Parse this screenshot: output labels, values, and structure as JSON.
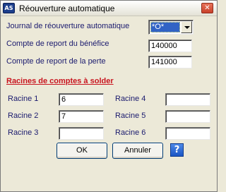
{
  "window": {
    "title": "Réouverture automatique",
    "app_icon_text": "AS",
    "close_glyph": "✕"
  },
  "form": {
    "journal_label": "Journal de réouverture automatique",
    "journal_value": "*O*",
    "benefice_label": "Compte de report du bénéfice",
    "benefice_value": "140000",
    "perte_label": "Compte de report de la perte",
    "perte_value": "141000"
  },
  "section": {
    "title": "Racines de comptes à solder"
  },
  "racines": [
    {
      "label": "Racine 1",
      "value": "6"
    },
    {
      "label": "Racine 2",
      "value": "7"
    },
    {
      "label": "Racine 3",
      "value": ""
    },
    {
      "label": "Racine 4",
      "value": ""
    },
    {
      "label": "Racine 5",
      "value": ""
    },
    {
      "label": "Racine 6",
      "value": ""
    }
  ],
  "buttons": {
    "ok": "OK",
    "cancel": "Annuler",
    "help": "?"
  }
}
